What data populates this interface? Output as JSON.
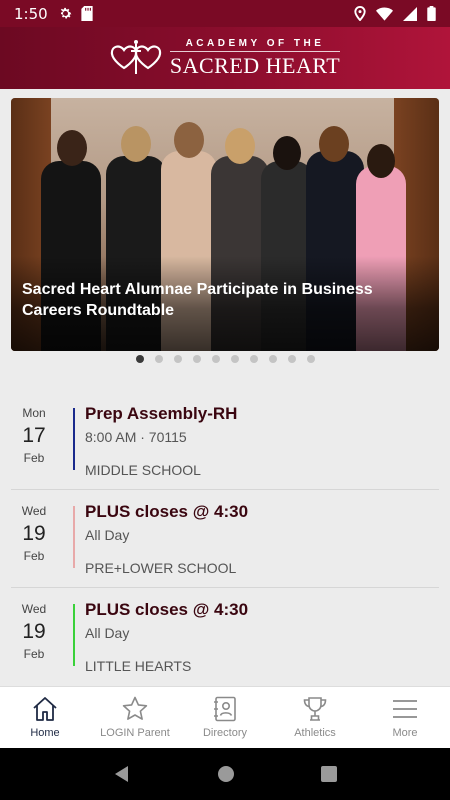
{
  "status_bar": {
    "time": "1:50",
    "left_icons": [
      "gear-icon",
      "sd-card-icon"
    ],
    "right_icons": [
      "location-icon",
      "wifi-icon",
      "signal-icon",
      "battery-icon"
    ]
  },
  "header": {
    "logo_top": "ACADEMY OF THE",
    "logo_bottom": "SACRED HEART",
    "brand_color": "#8a0d2c"
  },
  "carousel": {
    "caption": "Sacred Heart Alumnae Participate in Business Careers Roundtable",
    "slide_count": 10,
    "active_index": 0
  },
  "events": [
    {
      "dow": "Mon",
      "day": "17",
      "month": "Feb",
      "title": "Prep Assembly-RH",
      "time": "8:00 AM · 70115",
      "category": "MIDDLE SCHOOL",
      "color": "#1a2a8c"
    },
    {
      "dow": "Wed",
      "day": "19",
      "month": "Feb",
      "title": "PLUS closes @ 4:30",
      "time": "All Day",
      "category": "PRE+LOWER SCHOOL",
      "color": "#e8a9a9"
    },
    {
      "dow": "Wed",
      "day": "19",
      "month": "Feb",
      "title": "PLUS closes @ 4:30",
      "time": "All Day",
      "category": "LITTLE HEARTS",
      "color": "#3ad13a"
    }
  ],
  "tabs": [
    {
      "label": "Home",
      "icon": "home-icon",
      "active": true
    },
    {
      "label": "LOGIN Parent",
      "icon": "star-icon",
      "active": false
    },
    {
      "label": "Directory",
      "icon": "contact-card-icon",
      "active": false
    },
    {
      "label": "Athletics",
      "icon": "trophy-icon",
      "active": false
    },
    {
      "label": "More",
      "icon": "menu-icon",
      "active": false
    }
  ],
  "nav_bar": [
    "back-icon",
    "home-circle-icon",
    "recents-icon"
  ]
}
